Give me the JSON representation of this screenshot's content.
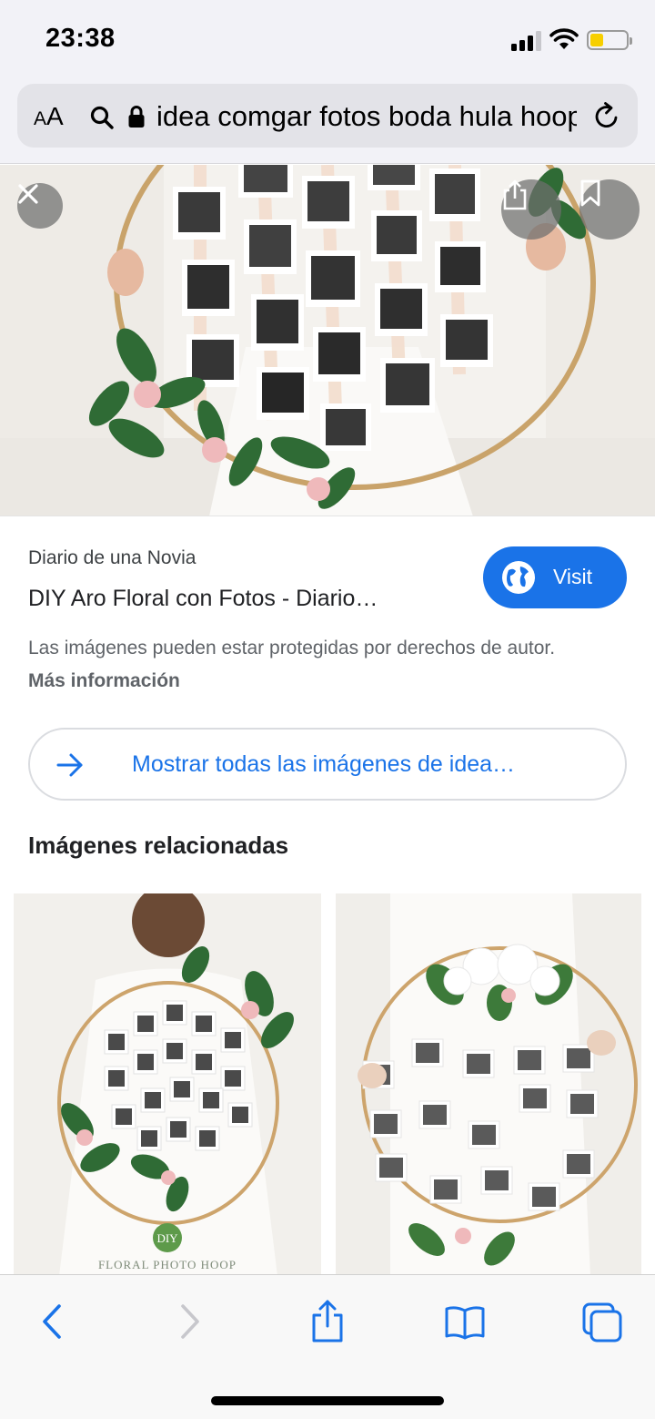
{
  "status_bar": {
    "time": "23:38",
    "battery_color": "#f7cf00"
  },
  "browser": {
    "text_size_label": "AA",
    "url": "idea comgar fotos boda hula hoop",
    "icons": [
      "search-icon",
      "lock-icon",
      "reload-icon"
    ]
  },
  "viewer": {
    "close_icon": "close-icon",
    "share_icon": "share-icon",
    "bookmark_icon": "bookmark-icon"
  },
  "result": {
    "source": "Diario de una Novia",
    "title": "DIY Aro Floral con Fotos - Diario…",
    "visit_label": "Visit",
    "copyright_text": "Las imágenes pueden estar protegidas por derechos de autor.",
    "more_info": "Más información"
  },
  "show_all": {
    "label": "Mostrar todas las imágenes de idea…"
  },
  "related": {
    "heading": "Imágenes relacionadas",
    "items": [
      {
        "badge": "DIY",
        "caption": "FLORAL PHOTO HOOP"
      },
      {
        "badge": "",
        "caption": ""
      }
    ]
  },
  "toolbar": {
    "items": [
      "back-icon",
      "forward-icon",
      "share-icon",
      "bookmarks-icon",
      "tabs-icon"
    ]
  },
  "colors": {
    "accent": "#1a73e8",
    "toolbar_icon": "#1a73e8",
    "disabled_icon": "#c7c7cc"
  }
}
